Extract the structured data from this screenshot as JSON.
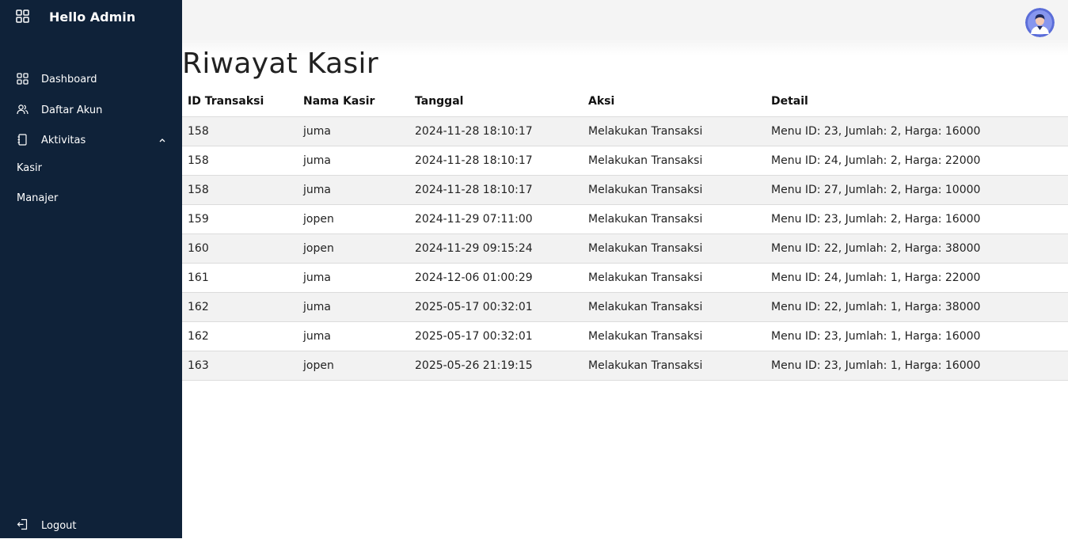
{
  "sidebar": {
    "brand_title": "Hello Admin",
    "brand_icon": "grid-icon",
    "items": [
      {
        "label": "Dashboard",
        "icon": "grid-icon"
      },
      {
        "label": "Daftar Akun",
        "icon": "users-icon"
      },
      {
        "label": "Aktivitas",
        "icon": "notebook-icon",
        "expanded": true
      }
    ],
    "sub_items": [
      {
        "label": "Kasir"
      },
      {
        "label": "Manajer"
      }
    ],
    "logout_label": "Logout",
    "logout_icon": "logout-icon"
  },
  "header": {
    "avatar_icon": "user-avatar-icon"
  },
  "main": {
    "title": "Riwayat Kasir",
    "columns": [
      "ID Transaksi",
      "Nama Kasir",
      "Tanggal",
      "Aksi",
      "Detail"
    ],
    "rows": [
      [
        "158",
        "juma",
        "2024-11-28 18:10:17",
        "Melakukan Transaksi",
        "Menu ID: 23, Jumlah: 2, Harga: 16000"
      ],
      [
        "158",
        "juma",
        "2024-11-28 18:10:17",
        "Melakukan Transaksi",
        "Menu ID: 24, Jumlah: 2, Harga: 22000"
      ],
      [
        "158",
        "juma",
        "2024-11-28 18:10:17",
        "Melakukan Transaksi",
        "Menu ID: 27, Jumlah: 2, Harga: 10000"
      ],
      [
        "159",
        "jopen",
        "2024-11-29 07:11:00",
        "Melakukan Transaksi",
        "Menu ID: 23, Jumlah: 2, Harga: 16000"
      ],
      [
        "160",
        "jopen",
        "2024-11-29 09:15:24",
        "Melakukan Transaksi",
        "Menu ID: 22, Jumlah: 2, Harga: 38000"
      ],
      [
        "161",
        "juma",
        "2024-12-06 01:00:29",
        "Melakukan Transaksi",
        "Menu ID: 24, Jumlah: 1, Harga: 22000"
      ],
      [
        "162",
        "juma",
        "2025-05-17 00:32:01",
        "Melakukan Transaksi",
        "Menu ID: 22, Jumlah: 1, Harga: 38000"
      ],
      [
        "162",
        "juma",
        "2025-05-17 00:32:01",
        "Melakukan Transaksi",
        "Menu ID: 23, Jumlah: 1, Harga: 16000"
      ],
      [
        "163",
        "jopen",
        "2025-05-26 21:19:15",
        "Melakukan Transaksi",
        "Menu ID: 23, Jumlah: 1, Harga: 16000"
      ]
    ]
  },
  "colors": {
    "sidebar_bg": "#0f2239",
    "row_stripe": "#f2f2f2",
    "avatar_bg": "#5b6dd8"
  }
}
